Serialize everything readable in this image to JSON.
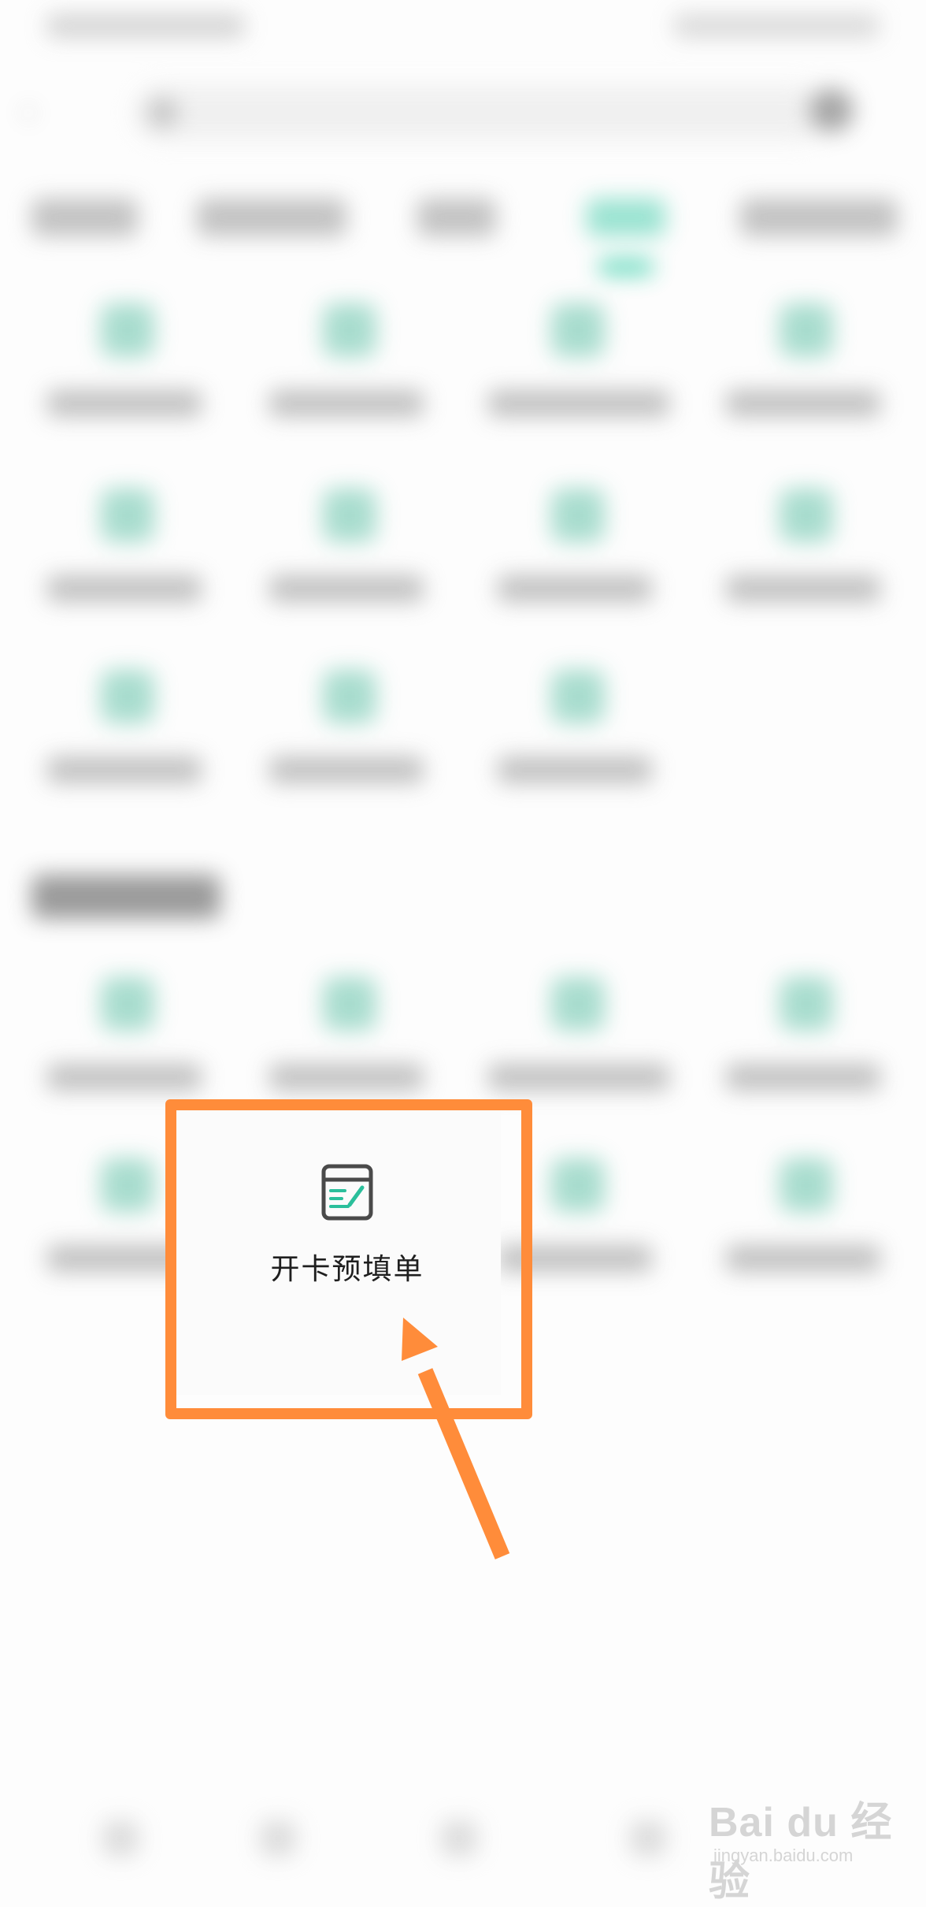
{
  "highlight": {
    "label": "开卡预填单",
    "icon": "form-edit-icon"
  },
  "annotation": {
    "frame_color": "#ff8c3a",
    "arrow_color": "#ff8c3a"
  },
  "watermark": {
    "text": "Bai du 经验",
    "sub": "jingyan.baidu.com"
  },
  "colors": {
    "accent": "#2bbf9b",
    "icon_stroke": "#4a4a4a"
  }
}
